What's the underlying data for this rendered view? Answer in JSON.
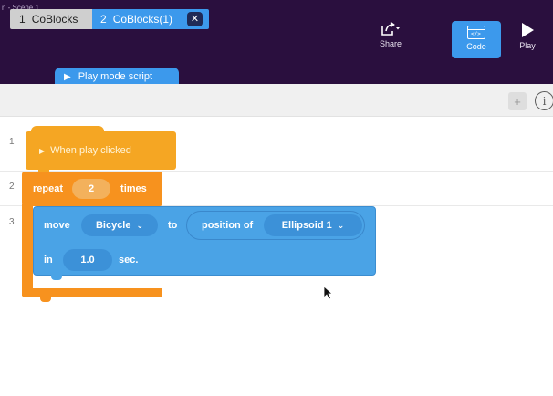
{
  "window": {
    "scene_label": "n - Scene 1"
  },
  "toolbar": {
    "share_label": "Share",
    "code_label": "Code",
    "play_label": "Play",
    "code_icon_text": "</>",
    "active_color": "#3c99ec"
  },
  "script_tab": {
    "label": "Play mode script"
  },
  "tabs": [
    {
      "number": "1",
      "label": "CoBlocks"
    },
    {
      "number": "2",
      "label": "CoBlocks(1)"
    }
  ],
  "tab_actions": {
    "add": "+",
    "info": "i",
    "close": "✕"
  },
  "lines": [
    "1",
    "2",
    "3"
  ],
  "blocks": {
    "hat_label": "When play clicked",
    "repeat_label": "repeat",
    "repeat_count": "2",
    "times_label": "times",
    "move_label": "move",
    "move_object": "Bicycle",
    "to_label": "to",
    "position_of_label": "position of",
    "target_object": "Ellipsoid 1",
    "in_label": "in",
    "duration": "1.0",
    "sec_label": "sec."
  },
  "colors": {
    "header": "#2a0f3e",
    "event_block": "#f5a623",
    "control_block": "#f7921e",
    "motion_block": "#4aa3e6"
  }
}
